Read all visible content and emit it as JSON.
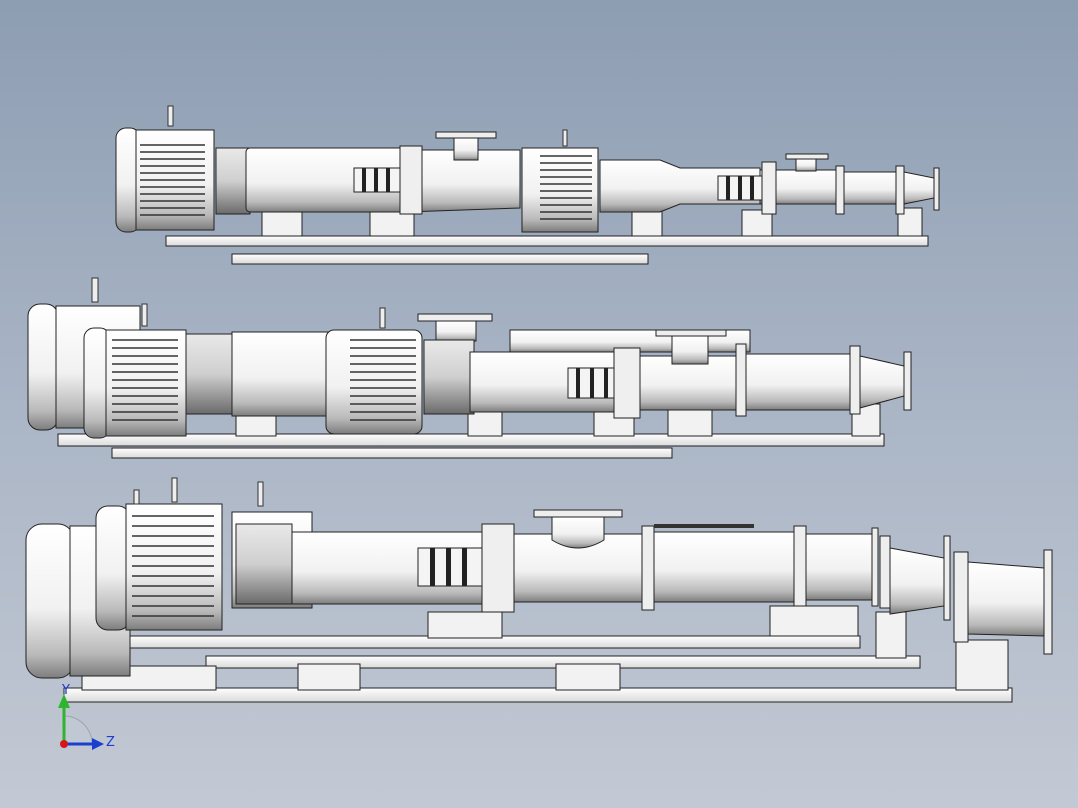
{
  "viewport": {
    "background_top": "#8d9db2",
    "background_bottom": "#c3c9d4"
  },
  "assemblies": [
    {
      "name": "small-screw-pump-assembly",
      "row": 1
    },
    {
      "name": "medium-screw-pump-assembly",
      "row": 2
    },
    {
      "name": "large-screw-pump-assembly",
      "row": 3
    }
  ],
  "triad": {
    "y_label": "Y",
    "z_label": "Z",
    "y_color": "#2db52d",
    "z_color": "#1a3fd0",
    "x_color": "#d01a1a"
  }
}
